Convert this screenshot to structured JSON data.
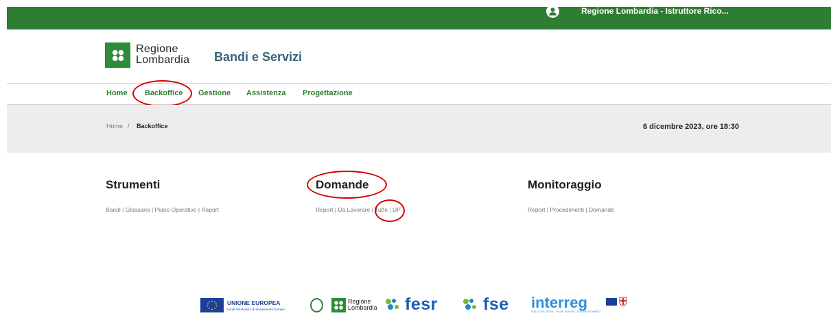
{
  "topbar": {
    "user_name": "Regione Lombardia - Istruttore Rico..."
  },
  "header": {
    "logo_line1": "Regione",
    "logo_line2": "Lombardia",
    "site_title": "Bandi e Servizi"
  },
  "nav": {
    "items": [
      {
        "label": "Home"
      },
      {
        "label": "Backoffice"
      },
      {
        "label": "Gestione"
      },
      {
        "label": "Assistenza"
      },
      {
        "label": "Progettazione"
      }
    ]
  },
  "breadcrumb": {
    "home": "Home",
    "separator": "/",
    "current": "Backoffice"
  },
  "datetime": "6 dicembre 2023, ore 18:30",
  "sections": {
    "strumenti": {
      "title": "Strumenti",
      "links": [
        "Bandi",
        "Glossario",
        "Piano Operativo",
        "Report"
      ]
    },
    "domande": {
      "title": "Domande",
      "links": [
        "Report",
        "Da Lavorare",
        "Tutte",
        "UP"
      ]
    },
    "monitoraggio": {
      "title": "Monitoraggio",
      "links": [
        "Report",
        "Procedimenti",
        "Domande"
      ]
    }
  },
  "footer": {
    "eu_title": "UNIONE EUROPEA",
    "eu_subtitle": "Fondi Strutturali e di Investimento Europei",
    "rl_line1": "Regione",
    "rl_line2": "Lombardia",
    "fesr": "fesr",
    "fse": "fse",
    "interreg": "interreg",
    "interreg_sub": "ITALIA SVIZZERA · ITALIE SUISSE · ITALIEN SCHWEIZ"
  },
  "colors": {
    "brand_green": "#2e7d32",
    "annotation_red": "#d40000",
    "interreg_blue": "#2f8ddc",
    "fesr_blue": "#1e5db8"
  },
  "icons": {
    "user": "user-avatar-icon",
    "logo": "regione-lombardia-logo-icon",
    "fesr": "fesr-leaf-icon"
  }
}
